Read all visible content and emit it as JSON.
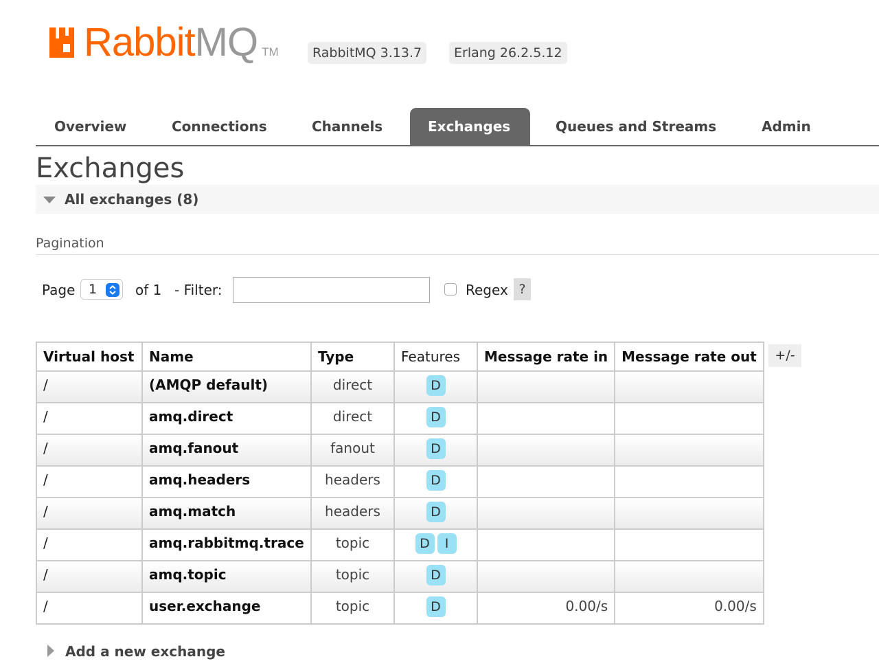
{
  "header": {
    "logo_rabbit": "Rabbit",
    "logo_mq": "MQ",
    "logo_tm": "TM",
    "rabbitmq_version": "RabbitMQ 3.13.7",
    "erlang_version": "Erlang 26.2.5.12",
    "brand_color": "#ff6600"
  },
  "tabs": [
    {
      "label": "Overview",
      "active": false
    },
    {
      "label": "Connections",
      "active": false
    },
    {
      "label": "Channels",
      "active": false
    },
    {
      "label": "Exchanges",
      "active": true
    },
    {
      "label": "Queues and Streams",
      "active": false
    },
    {
      "label": "Admin",
      "active": false
    }
  ],
  "page": {
    "title": "Exchanges",
    "section_title": "All exchanges (8)"
  },
  "pagination": {
    "heading": "Pagination",
    "page_label": "Page",
    "page_value": "1",
    "of_label": "of 1",
    "filter_label": "- Filter:",
    "filter_value": "",
    "regex_label": "Regex",
    "regex_checked": false,
    "help_label": "?"
  },
  "table": {
    "columns": [
      "Virtual host",
      "Name",
      "Type",
      "Features",
      "Message rate in",
      "Message rate out"
    ],
    "toggle_label": "+/-",
    "rows": [
      {
        "vhost": "/",
        "name": "(AMQP default)",
        "type": "direct",
        "features": [
          "D"
        ],
        "rate_in": "",
        "rate_out": ""
      },
      {
        "vhost": "/",
        "name": "amq.direct",
        "type": "direct",
        "features": [
          "D"
        ],
        "rate_in": "",
        "rate_out": ""
      },
      {
        "vhost": "/",
        "name": "amq.fanout",
        "type": "fanout",
        "features": [
          "D"
        ],
        "rate_in": "",
        "rate_out": ""
      },
      {
        "vhost": "/",
        "name": "amq.headers",
        "type": "headers",
        "features": [
          "D"
        ],
        "rate_in": "",
        "rate_out": ""
      },
      {
        "vhost": "/",
        "name": "amq.match",
        "type": "headers",
        "features": [
          "D"
        ],
        "rate_in": "",
        "rate_out": ""
      },
      {
        "vhost": "/",
        "name": "amq.rabbitmq.trace",
        "type": "topic",
        "features": [
          "D",
          "I"
        ],
        "rate_in": "",
        "rate_out": ""
      },
      {
        "vhost": "/",
        "name": "amq.topic",
        "type": "topic",
        "features": [
          "D"
        ],
        "rate_in": "",
        "rate_out": ""
      },
      {
        "vhost": "/",
        "name": "user.exchange",
        "type": "topic",
        "features": [
          "D"
        ],
        "rate_in": "0.00/s",
        "rate_out": "0.00/s"
      }
    ]
  },
  "add_section": {
    "title": "Add a new exchange"
  }
}
